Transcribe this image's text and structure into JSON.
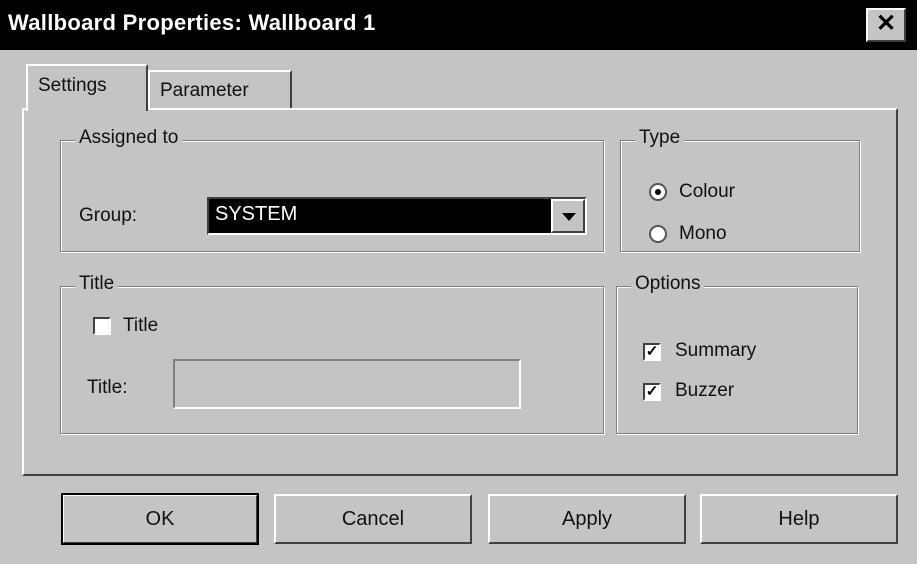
{
  "window": {
    "title": "Wallboard Properties: Wallboard  1",
    "close_glyph": "✕"
  },
  "tabs": [
    {
      "label": "Settings",
      "active": true
    },
    {
      "label": "Parameter",
      "active": false
    }
  ],
  "assigned_to": {
    "legend": "Assigned to",
    "group_label": "Group:",
    "group_value": "SYSTEM"
  },
  "type": {
    "legend": "Type",
    "options": [
      {
        "label": "Colour",
        "selected": true
      },
      {
        "label": "Mono",
        "selected": false
      }
    ]
  },
  "title_group": {
    "legend": "Title",
    "checkbox_label": "Title",
    "checkbox_checked": false,
    "field_label": "Title:",
    "field_value": ""
  },
  "options": {
    "legend": "Options",
    "items": [
      {
        "label": "Summary",
        "checked": true
      },
      {
        "label": "Buzzer",
        "checked": true
      }
    ]
  },
  "buttons": {
    "ok": "OK",
    "cancel": "Cancel",
    "apply": "Apply",
    "help": "Help"
  },
  "icons": {
    "check_glyph": "✓",
    "dropdown": "chevron-down-icon",
    "close": "close-icon"
  }
}
